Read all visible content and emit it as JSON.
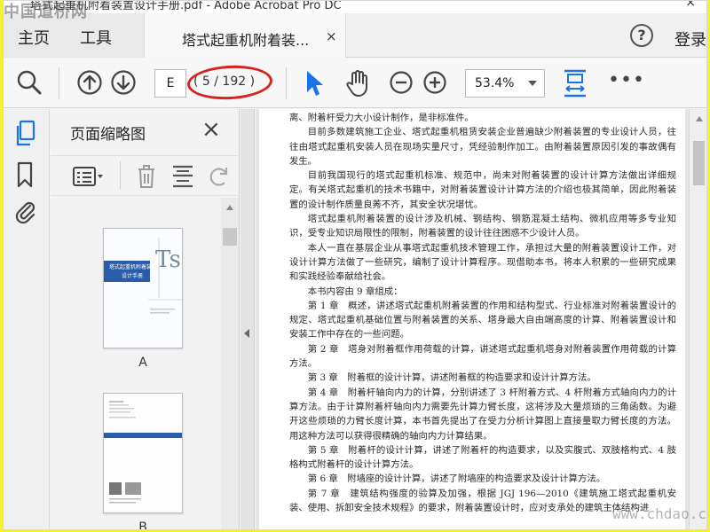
{
  "window": {
    "title": "塔式起重机附着装置设计手册.pdf - Adobe Acrobat Pro DC",
    "close_glyph": "×"
  },
  "menu": {
    "home_label": "主页",
    "tools_label": "工具",
    "tab_label": "塔式起重机附着装...",
    "tab_close": "×",
    "help_glyph": "?",
    "login_label": "登录"
  },
  "toolbar": {
    "page_input_value": "E",
    "page_count": "( 5 / 192 )",
    "zoom_value": "53.4%",
    "more_glyph": "•••",
    "accent_color": "#1a73e8"
  },
  "panel": {
    "title": "页面缩略图",
    "close_glyph": "×",
    "thumbnails": [
      {
        "label": "A",
        "cover_title": "塔式起重机附着装置",
        "cover_subtitle": "设计手册",
        "cover_mark": "Ts"
      },
      {
        "label": "B"
      }
    ]
  },
  "document": {
    "paragraphs": [
      {
        "indent": false,
        "text": "离、附着杆受力大小设计制作，是非标准件。"
      },
      {
        "indent": true,
        "text": "目前多数建筑施工企业、塔式起重机租赁安装企业普遍缺少附着装置的专业设计人员，往往由塔式起重机安装人员在现场实量尺寸，凭经验制作加工。由附着装置原因引发的事故偶有发生。"
      },
      {
        "indent": true,
        "text": "目前我国现行的塔式起重机标准、规范中，尚未对附着装置的设计计算方法做出详细规定。有关塔式起重机的技术书籍中，对附着装置设计计算方法的介绍也极其简单，因此附着装置的设计制作质量良莠不齐，其安全状况堪忧。"
      },
      {
        "indent": true,
        "text": "塔式起重机附着装置的设计涉及机械、钢结构、钢筋混凝土结构、微机应用等多专业知识，受专业知识局限性的限制，附着装置的设计往往困惑不少设计人员。"
      },
      {
        "indent": true,
        "text": "本人一直在基层企业从事塔式起重机技术管理工作，承担过大量的附着装置设计工作，对设计计算方法做了一些研究，编制了设计计算程序。现借助本书，将本人积累的一些研究成果和实践经验奉献给社会。"
      },
      {
        "indent": true,
        "text": "本书内容由 9 章组成："
      },
      {
        "indent": true,
        "text": "第 1 章　概述，讲述塔式起重机附着装置的作用和结构型式、行业标准对附着装置设计的规定、塔式起重机基础位置与附着装置的关系、塔身最大自由端高度的计算、附着装置设计和安装工作中存在的一些问题。"
      },
      {
        "indent": true,
        "text": "第 2 章　塔身对附着框作用荷载的计算，讲述塔式起重机塔身对附着装置作用荷载的计算方法。"
      },
      {
        "indent": true,
        "text": "第 3 章　附着框的设计计算，讲述附着框的构造要求和设计计算方法。"
      },
      {
        "indent": true,
        "text": "第 4 章　附着杆轴向内力的计算，分别讲述了 3 杆附着方式、4 杆附着方式轴向内力的计算方法。由于计算附着杆轴向内力需要先计算力臂长度，这将涉及大量烦琐的三角函数。为避开这些烦琐的力臂长度计算，本书首先提出了在受力分析计算图上直接量取力臂长度的方法。用这种方法可以获得很精确的轴向内力计算结果。"
      },
      {
        "indent": true,
        "text": "第 5 章　附着杆的设计计算，讲述了附着杆的构造要求，以及实腹式、双肢格构式、4 肢格构式附着杆的设计计算方法。"
      },
      {
        "indent": true,
        "text": "第 6 章　附墙座的设计计算，讲述了附墙座的构造要求及设计计算方法。"
      },
      {
        "indent": true,
        "text": "第 7 章　建筑结构强度的验算及加强，根据 JGJ 196—2010《建筑施工塔式起重机安装、使用、拆卸安全技术规程》的要求，附着装置设计时，应对支承处的建筑主体结构进"
      }
    ]
  },
  "watermarks": {
    "top_left": "中国道桥网",
    "bottom_right": "www.chdao.com"
  }
}
